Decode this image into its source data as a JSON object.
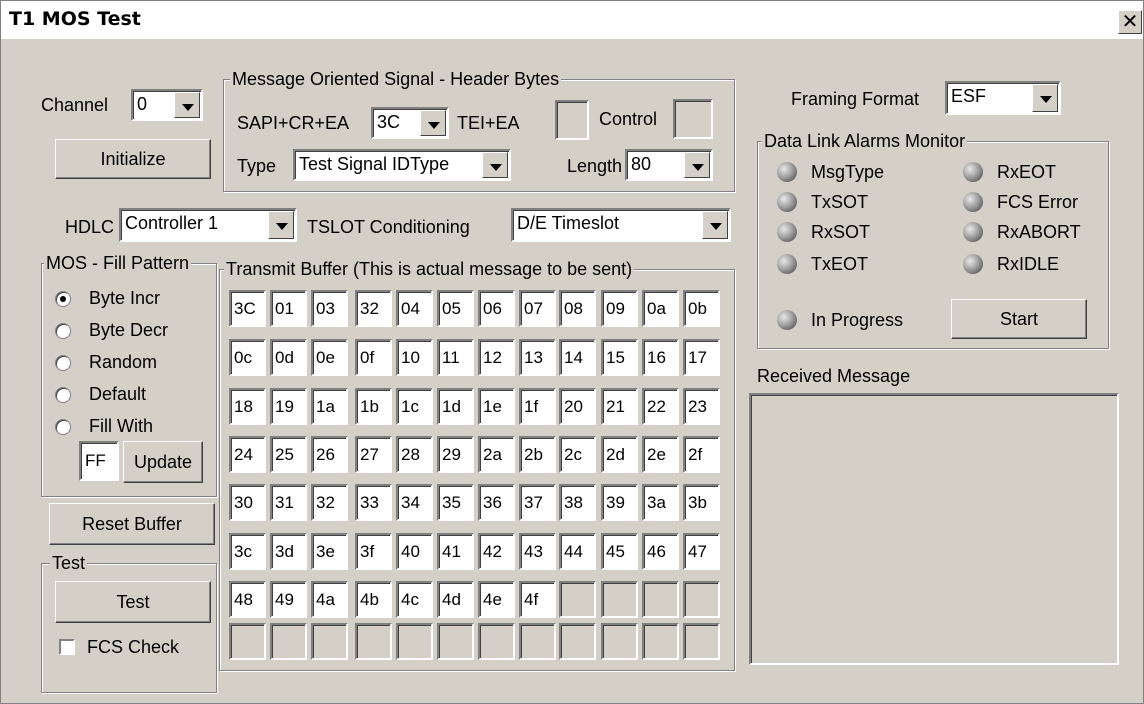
{
  "window": {
    "title": "T1 MOS Test",
    "close_glyph": "✕"
  },
  "channel": {
    "label": "Channel",
    "value": "0"
  },
  "initialize_label": "Initialize",
  "header_bytes": {
    "title": "Message Oriented Signal - Header Bytes",
    "sapi_label": "SAPI+CR+EA",
    "sapi_value": "3C",
    "tei_label": "TEI+EA",
    "tei_value": "",
    "control_label": "Control",
    "control_value": "",
    "type_label": "Type",
    "type_value": "Test Signal IDType",
    "length_label": "Length",
    "length_value": "80"
  },
  "hdlc": {
    "label": "HDLC",
    "value": "Controller 1"
  },
  "tslot": {
    "label": "TSLOT Conditioning",
    "value": "D/E Timeslot"
  },
  "fill_pattern": {
    "title": "MOS - Fill Pattern",
    "options": [
      {
        "label": "Byte Incr",
        "selected": true
      },
      {
        "label": "Byte Decr",
        "selected": false
      },
      {
        "label": "Random",
        "selected": false
      },
      {
        "label": "Default",
        "selected": false
      },
      {
        "label": "Fill With",
        "selected": false
      }
    ],
    "fill_value": "FF",
    "update_label": "Update"
  },
  "reset_buffer_label": "Reset Buffer",
  "test_group": {
    "title": "Test",
    "test_label": "Test",
    "fcs_label": "FCS Check",
    "fcs_checked": false
  },
  "transmit_buffer": {
    "title": "Transmit Buffer (This is actual message to be sent)",
    "bytes": [
      "3C",
      "01",
      "03",
      "32",
      "04",
      "05",
      "06",
      "07",
      "08",
      "09",
      "0a",
      "0b",
      "0c",
      "0d",
      "0e",
      "0f",
      "10",
      "11",
      "12",
      "13",
      "14",
      "15",
      "16",
      "17",
      "18",
      "19",
      "1a",
      "1b",
      "1c",
      "1d",
      "1e",
      "1f",
      "20",
      "21",
      "22",
      "23",
      "24",
      "25",
      "26",
      "27",
      "28",
      "29",
      "2a",
      "2b",
      "2c",
      "2d",
      "2e",
      "2f",
      "30",
      "31",
      "32",
      "33",
      "34",
      "35",
      "36",
      "37",
      "38",
      "39",
      "3a",
      "3b",
      "3c",
      "3d",
      "3e",
      "3f",
      "40",
      "41",
      "42",
      "43",
      "44",
      "45",
      "46",
      "47",
      "48",
      "49",
      "4a",
      "4b",
      "4c",
      "4d",
      "4e",
      "4f",
      "",
      "",
      "",
      "",
      "",
      "",
      "",
      "",
      "",
      "",
      "",
      "",
      "",
      "",
      "",
      ""
    ]
  },
  "framing": {
    "label": "Framing Format",
    "value": "ESF"
  },
  "alarms": {
    "title": "Data Link Alarms Monitor",
    "items": [
      "MsgType",
      "RxEOT",
      "TxSOT",
      "FCS Error",
      "RxSOT",
      "RxABORT",
      "TxEOT",
      "RxIDLE"
    ],
    "in_progress_label": "In Progress",
    "start_label": "Start"
  },
  "received": {
    "label": "Received Message",
    "value": ""
  }
}
